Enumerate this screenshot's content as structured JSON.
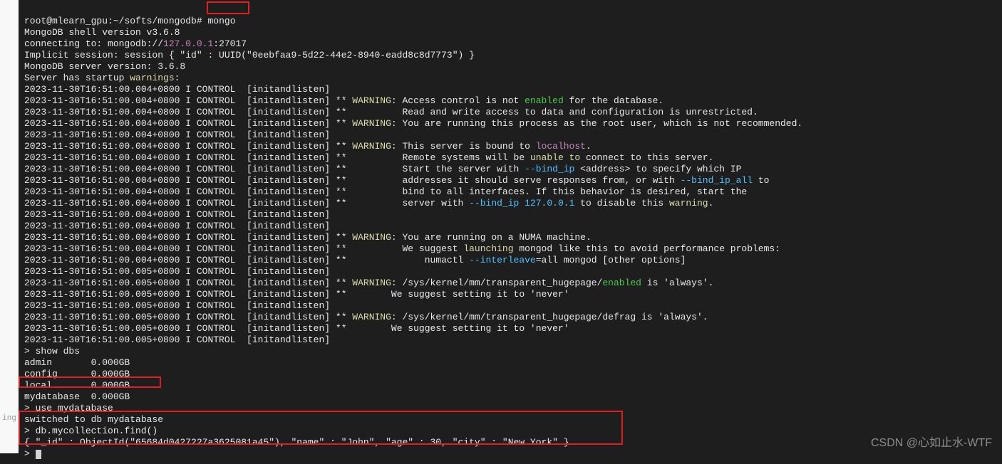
{
  "prompt": {
    "user": "root@mlearn_gpu",
    "path": "~/softs/mongodb",
    "cmd": "mongo"
  },
  "shell_version": "MongoDB shell version v3.6.8",
  "connecting": "connecting to: mongodb://",
  "connect_host": "127.0.0.1",
  "connect_port": ":27017",
  "implicit_session": "Implicit session: session { \"id\" : UUID(\"0eebfaa9-5d22-44e2-8940-eadd8c8d7773\") }",
  "server_version": "MongoDB server version: 3.6.8",
  "warnings_label": "Server has startup ",
  "warnings_word": "warnings",
  "ts_004": "2023-11-30T16:51:00.004+0800 I CONTROL  [initandlisten]",
  "ts_005": "2023-11-30T16:51:00.005+0800 I CONTROL  [initandlisten]",
  "w1": {
    "prefix": "** ",
    "warn": "WARNING",
    "text": ": Access control is not ",
    "enabled": "enabled",
    "text2": " for the database."
  },
  "w1b": "**          Read and write access to data and configuration is unrestricted.",
  "w2": "** WARNING: You are running this process as the root user, which is not recommended.",
  "w3": {
    "a": "** WARNING: This server is bound to ",
    "host": "localhost",
    "b": "."
  },
  "w3b": {
    "a": "**          Remote systems will be ",
    "unable": "unable to",
    "b": " connect to this server."
  },
  "w3c": {
    "a": "**          Start the server with ",
    "flag": "--bind_ip",
    "b": " <address> to specify which IP"
  },
  "w3d": {
    "a": "**          addresses it should serve responses from, or with ",
    "flag": "--bind_ip_all",
    "b": " to"
  },
  "w3e": "**          bind to all interfaces. If this behavior is desired, start the",
  "w3f": {
    "a": "**          server with ",
    "flag": "--bind_ip 127.0.0.1",
    "b": " to disable this ",
    "warn": "warning",
    "c": "."
  },
  "w4": "** WARNING: You are running on a NUMA machine.",
  "w4b": {
    "a": "**          We suggest ",
    "launch": "launching",
    "b": " mongod like this to avoid performance problems:"
  },
  "w4c": {
    "a": "**              numactl ",
    "flag": "--interleave",
    "b": "=all mongod [other options]"
  },
  "w5": {
    "a": "** WARNING: /sys/kernel/mm/transparent_hugepage/",
    "en": "enabled",
    "b": " is 'always'."
  },
  "w5b": "**        We suggest setting it to 'never'",
  "w6": "** WARNING: /sys/kernel/mm/transparent_hugepage/defrag is 'always'.",
  "w6b": "**        We suggest setting it to 'never'",
  "shell": {
    "show_dbs": "> show dbs",
    "dbs": [
      "admin       0.000GB",
      "config      0.000GB",
      "local       0.000GB",
      "mydatabase  0.000GB"
    ],
    "use": "> use mydatabase",
    "switched": "switched to db mydatabase",
    "find": "> db.mycollection.find()",
    "result": "{ \"_id\" : ObjectId(\"65684d0427227a3625081a45\"), \"name\" : \"John\", \"age\" : 30, \"city\" : \"New York\" }",
    "prompt": "> "
  },
  "gutter": "ing",
  "watermark": "CSDN @心如止水-WTF"
}
